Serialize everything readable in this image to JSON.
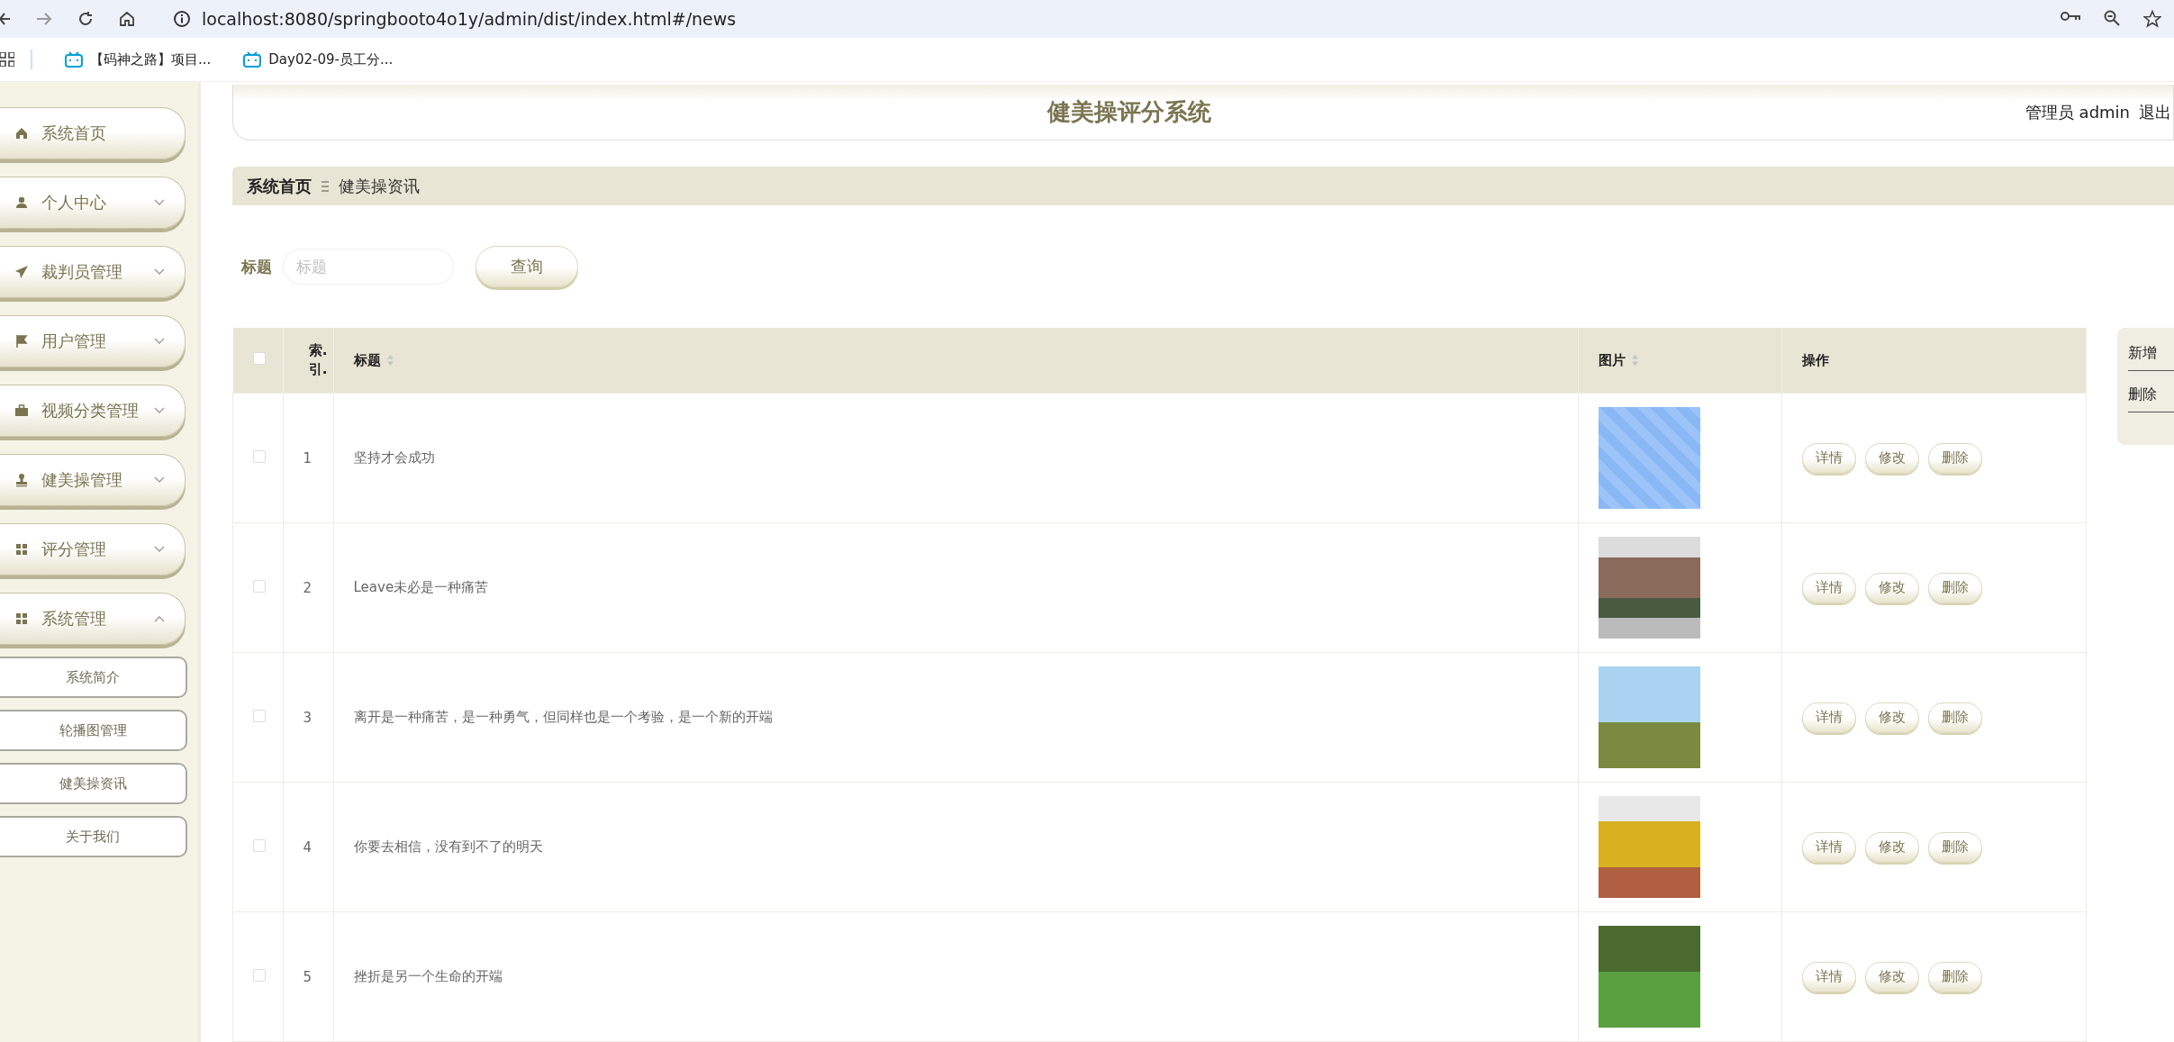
{
  "browser": {
    "url": "localhost:8080/springbooto4o1y/admin/dist/index.html#/news",
    "bookmarks": [
      {
        "label": "【码神之路】项目..."
      },
      {
        "label": "Day02-09-员工分..."
      }
    ]
  },
  "sidebar": {
    "items": [
      {
        "label": "系统首页",
        "kind": "link"
      },
      {
        "label": "个人中心",
        "kind": "group",
        "expanded": false
      },
      {
        "label": "裁判员管理",
        "kind": "group",
        "expanded": false
      },
      {
        "label": "用户管理",
        "kind": "group",
        "expanded": false
      },
      {
        "label": "视频分类管理",
        "kind": "group",
        "expanded": false
      },
      {
        "label": "健美操管理",
        "kind": "group",
        "expanded": false
      },
      {
        "label": "评分管理",
        "kind": "group",
        "expanded": false
      },
      {
        "label": "系统管理",
        "kind": "group",
        "expanded": true,
        "children": [
          {
            "label": "系统简介"
          },
          {
            "label": "轮播图管理"
          },
          {
            "label": "健美操资讯"
          },
          {
            "label": "关于我们"
          }
        ]
      }
    ]
  },
  "header": {
    "title": "健美操评分系统",
    "user": "管理员 admin",
    "logout": "退出"
  },
  "breadcrumb": [
    "系统首页",
    "健美操资讯"
  ],
  "search": {
    "label": "标题",
    "placeholder": "标题",
    "button": "查询"
  },
  "table": {
    "all_checked": false,
    "columns": [
      {
        "label": "索.引.",
        "kind": "plain"
      },
      {
        "label": "标题",
        "kind": "sortable"
      },
      {
        "label": "图片",
        "kind": "sortable"
      },
      {
        "label": "操作",
        "kind": "plain"
      }
    ],
    "rows": [
      {
        "index": "1",
        "title": "坚持才会成功",
        "checked": false,
        "actions": [
          "详情",
          "修改",
          "删除"
        ]
      },
      {
        "index": "2",
        "title": "Leave未必是一种痛苦",
        "checked": false,
        "actions": [
          "详情",
          "修改",
          "删除"
        ]
      },
      {
        "index": "3",
        "title": "离开是一种痛苦，是一种勇气，但同样也是一个考验，是一个新的开端",
        "checked": false,
        "actions": [
          "详情",
          "修改",
          "删除"
        ]
      },
      {
        "index": "4",
        "title": "你要去相信，没有到不了的明天",
        "checked": false,
        "actions": [
          "详情",
          "修改",
          "删除"
        ]
      },
      {
        "index": "5",
        "title": "挫折是另一个生命的开端",
        "checked": false,
        "actions": [
          "详情",
          "修改",
          "删除"
        ]
      }
    ]
  },
  "side_actions": [
    "新增",
    "删除"
  ]
}
